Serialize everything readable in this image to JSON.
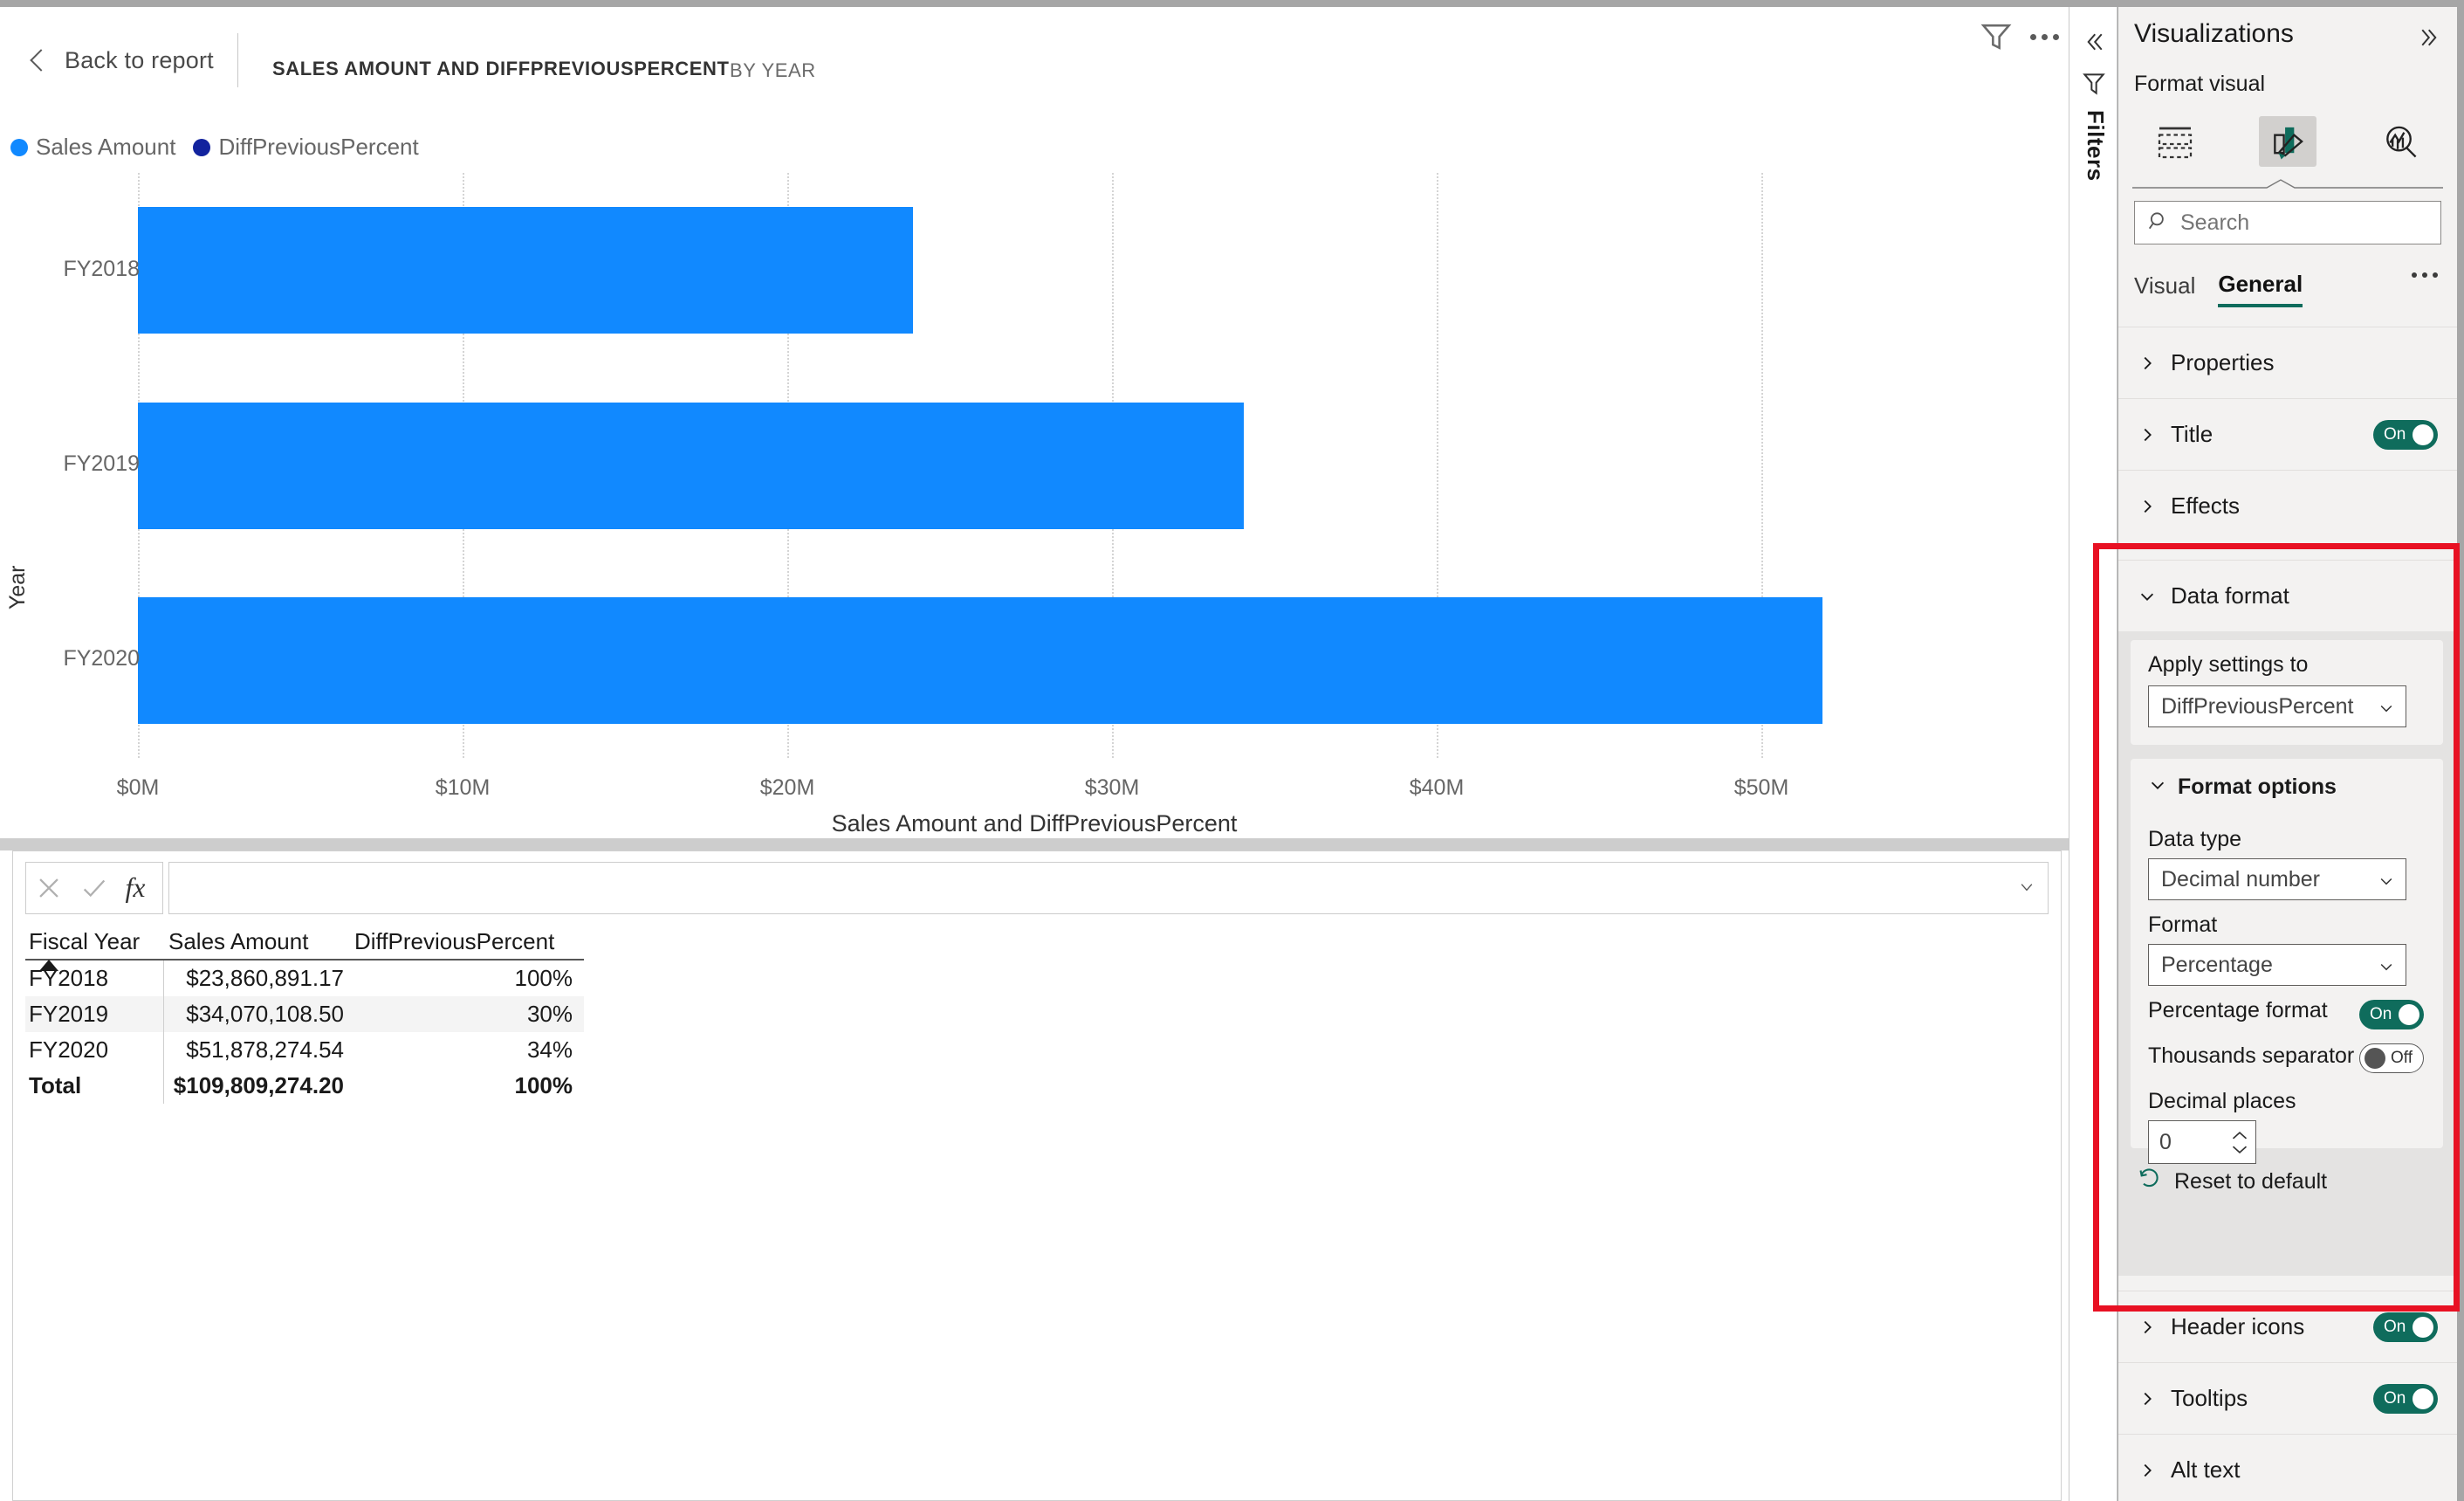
{
  "focus_header": {
    "back_label": "Back to report",
    "visual_title": "SALES AMOUNT AND DIFFPREVIOUSPERCENT",
    "visual_subtitle": "BY YEAR",
    "filter_icon": "funnel-icon",
    "more_icon": "ellipsis-icon"
  },
  "legend": {
    "items": [
      {
        "label": "Sales Amount",
        "color": "#1189ff"
      },
      {
        "label": "DiffPreviousPercent",
        "color": "#12239e"
      }
    ]
  },
  "chart_data": {
    "type": "bar",
    "orientation": "horizontal",
    "title": "SALES AMOUNT AND DIFFPREVIOUSPERCENT BY YEAR",
    "xlabel": "Sales Amount and DiffPreviousPercent",
    "ylabel": "Year",
    "categories": [
      "FY2018",
      "FY2019",
      "FY2020"
    ],
    "series": [
      {
        "name": "Sales Amount",
        "color": "#1189ff",
        "values": [
          23860891.17,
          34070108.5,
          51878274.54
        ]
      },
      {
        "name": "DiffPreviousPercent",
        "color": "#12239e",
        "values": [
          1.0,
          0.3,
          0.34
        ]
      }
    ],
    "xlim": [
      0,
      55000000
    ],
    "x_tick_values": [
      0,
      10000000,
      20000000,
      30000000,
      40000000,
      50000000
    ],
    "x_tick_labels": [
      "$0M",
      "$10M",
      "$20M",
      "$30M",
      "$40M",
      "$50M"
    ],
    "grid": true,
    "grid_style": "dotted vertical",
    "legend_position": "top-left"
  },
  "formula_bar": {
    "cancel_icon": "close-icon",
    "accept_icon": "check-icon",
    "function_icon": "fx-icon",
    "value": "",
    "placeholder": "",
    "expand_icon": "chevron-down-icon"
  },
  "grid": {
    "columns": [
      "Fiscal Year",
      "Sales Amount",
      "DiffPreviousPercent"
    ],
    "sort_column": "Fiscal Year",
    "sort_direction": "ascending",
    "rows": [
      {
        "fiscal_year": "FY2018",
        "sales_amount": "$23,860,891.17",
        "diff_previous_percent": "100%"
      },
      {
        "fiscal_year": "FY2019",
        "sales_amount": "$34,070,108.50",
        "diff_previous_percent": "30%"
      },
      {
        "fiscal_year": "FY2020",
        "sales_amount": "$51,878,274.54",
        "diff_previous_percent": "34%"
      }
    ],
    "total": {
      "fiscal_year": "Total",
      "sales_amount": "$109,809,274.20",
      "diff_previous_percent": "100%"
    }
  },
  "filters_rail": {
    "collapse_icon": "chevron-double-left-icon",
    "funnel_icon": "filter-funnel-icon",
    "label": "Filters"
  },
  "viz_panel": {
    "title": "Visualizations",
    "expand_icon": "chevron-double-right-icon",
    "format_visual_label": "Format visual",
    "icon_buttons": [
      {
        "name": "fields-icon",
        "active": false
      },
      {
        "name": "format-paint-roller-icon",
        "active": true
      },
      {
        "name": "analytics-magnifier-icon",
        "active": false
      }
    ],
    "search": {
      "placeholder": "Search",
      "value": "",
      "icon": "search-icon"
    },
    "tabs": [
      {
        "label": "Visual",
        "active": false
      },
      {
        "label": "General",
        "active": true
      }
    ],
    "tabs_more_icon": "ellipsis-icon",
    "accent_color": "#0f6c5c",
    "highlight_color": "#e81123",
    "sections": [
      {
        "label": "Properties",
        "expanded": false,
        "toggle": null
      },
      {
        "label": "Title",
        "expanded": false,
        "toggle": "On"
      },
      {
        "label": "Effects",
        "expanded": false,
        "toggle": null
      },
      {
        "label": "Data format",
        "expanded": true,
        "toggle": null,
        "highlighted": true
      },
      {
        "label": "Header icons",
        "expanded": false,
        "toggle": "On"
      },
      {
        "label": "Tooltips",
        "expanded": false,
        "toggle": "On"
      },
      {
        "label": "Alt text",
        "expanded": false,
        "toggle": null
      }
    ],
    "data_format": {
      "apply_settings_to_label": "Apply settings to",
      "apply_settings_to_value": "DiffPreviousPercent",
      "format_options_label": "Format options",
      "format_options_expanded": true,
      "data_type_label": "Data type",
      "data_type_value": "Decimal number",
      "format_label": "Format",
      "format_value": "Percentage",
      "percentage_format_label": "Percentage format",
      "percentage_format_toggle": "On",
      "thousands_separator_label": "Thousands separator",
      "thousands_separator_toggle": "Off",
      "decimal_places_label": "Decimal places",
      "decimal_places_value": "0",
      "reset_label": "Reset to default",
      "reset_icon": "undo-icon"
    }
  }
}
